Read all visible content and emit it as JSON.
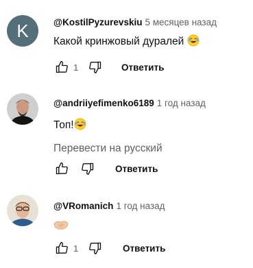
{
  "comments": [
    {
      "avatar_letter": "K",
      "avatar_color": "#546e7a",
      "author": "@KostilPyzurevskiu",
      "time": "5 месяцев назад",
      "text": "Какой кринжовый дуралей",
      "emoji": "laughing-emoji",
      "likes": "1",
      "reply_label": "Ответить"
    },
    {
      "author": "@andriiyefimenko6189",
      "time": "1 год назад",
      "text": "Топ!",
      "emoji": "laughing-emoji",
      "translate_label": "Перевести на русский",
      "likes": "",
      "reply_label": "Ответить"
    },
    {
      "author": "@VRomanich",
      "time": "1 год назад",
      "emoji": "handshake-emoji",
      "likes": "1",
      "reply_label": "Ответить"
    }
  ]
}
